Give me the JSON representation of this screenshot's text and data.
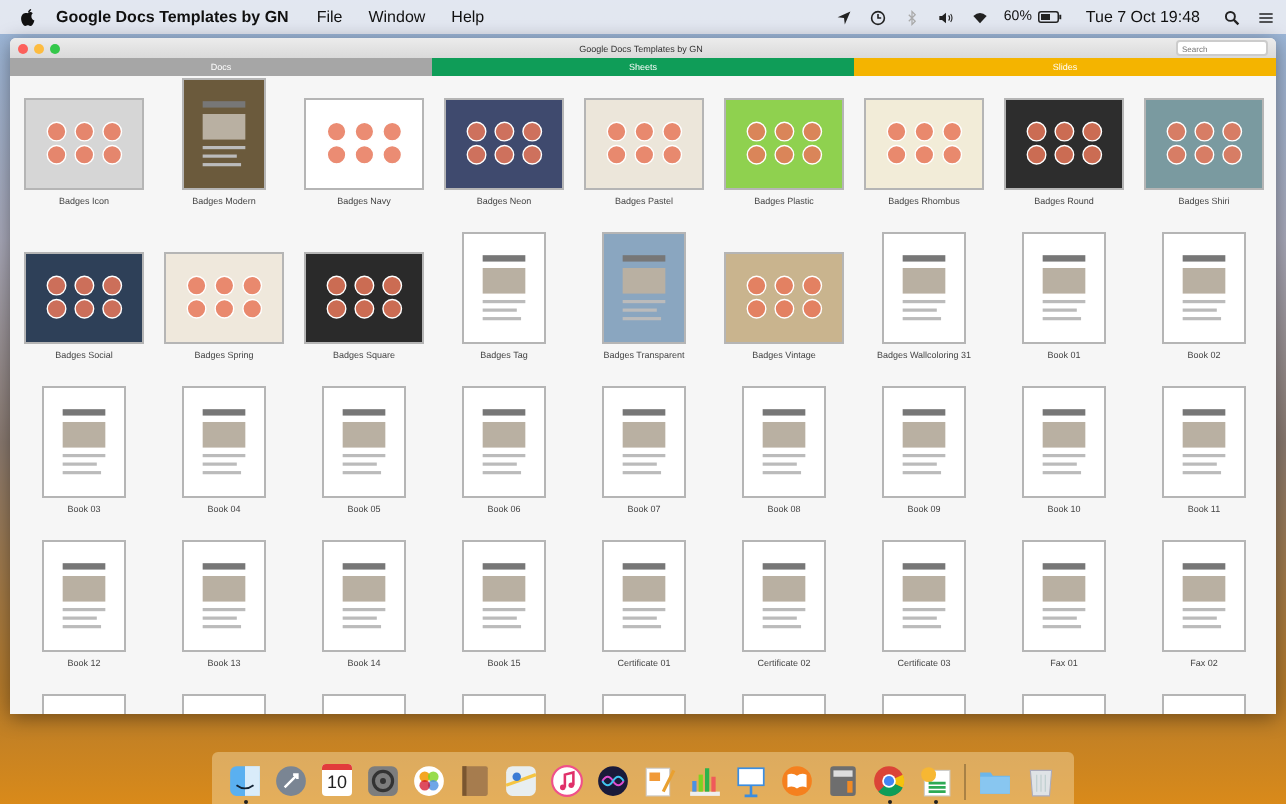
{
  "menu_bar": {
    "app_name": "Google Docs Templates by GN",
    "menus": [
      "File",
      "Window",
      "Help"
    ],
    "battery_text": "60%",
    "clock": "Tue 7 Oct  19:48"
  },
  "window": {
    "title": "Google Docs Templates by GN",
    "search": {
      "placeholder": "Search"
    }
  },
  "tabs": [
    {
      "label": "Docs",
      "color": "#a6a6a6"
    },
    {
      "label": "Sheets",
      "color": "#0f9d58"
    },
    {
      "label": "Slides",
      "color": "#f4b400"
    }
  ],
  "templates": [
    {
      "label": "Badges Icon",
      "kind": "landscape",
      "color": "#d6d6d6"
    },
    {
      "label": "Badges Modern",
      "kind": "portrait",
      "color": "#6b5a3c"
    },
    {
      "label": "Badges Navy",
      "kind": "landscape",
      "color": "#ffffff"
    },
    {
      "label": "Badges Neon",
      "kind": "landscape",
      "color": "#3f4a6e"
    },
    {
      "label": "Badges Pastel",
      "kind": "landscape",
      "color": "#ece6da"
    },
    {
      "label": "Badges Plastic",
      "kind": "landscape",
      "color": "#8fd14f"
    },
    {
      "label": "Badges Rhombus",
      "kind": "landscape",
      "color": "#f2ecd8"
    },
    {
      "label": "Badges Round",
      "kind": "landscape",
      "color": "#2d2d2d"
    },
    {
      "label": "Badges Shiri",
      "kind": "landscape",
      "color": "#7a9aa0"
    },
    {
      "label": "Badges Social",
      "kind": "landscape",
      "color": "#2e4058"
    },
    {
      "label": "Badges Spring",
      "kind": "landscape",
      "color": "#efe8dc"
    },
    {
      "label": "Badges Square",
      "kind": "landscape",
      "color": "#2a2a2a"
    },
    {
      "label": "Badges Tag",
      "kind": "portrait",
      "color": "#ffffff"
    },
    {
      "label": "Badges Transparent",
      "kind": "portrait",
      "color": "#8aa6c0"
    },
    {
      "label": "Badges Vintage",
      "kind": "landscape",
      "color": "#c9b48e"
    },
    {
      "label": "Badges Wallcoloring 31",
      "kind": "portrait",
      "color": "#ffffff"
    },
    {
      "label": "Book 01",
      "kind": "portrait",
      "color": "#ffffff"
    },
    {
      "label": "Book 02",
      "kind": "portrait",
      "color": "#ffffff"
    },
    {
      "label": "Book 03",
      "kind": "portrait",
      "color": "#ffffff"
    },
    {
      "label": "Book 04",
      "kind": "portrait",
      "color": "#ffffff"
    },
    {
      "label": "Book 05",
      "kind": "portrait",
      "color": "#ffffff"
    },
    {
      "label": "Book 06",
      "kind": "portrait",
      "color": "#ffffff"
    },
    {
      "label": "Book 07",
      "kind": "portrait",
      "color": "#ffffff"
    },
    {
      "label": "Book 08",
      "kind": "portrait",
      "color": "#ffffff"
    },
    {
      "label": "Book 09",
      "kind": "portrait",
      "color": "#ffffff"
    },
    {
      "label": "Book 10",
      "kind": "portrait",
      "color": "#ffffff"
    },
    {
      "label": "Book 11",
      "kind": "portrait",
      "color": "#ffffff"
    },
    {
      "label": "Book 12",
      "kind": "portrait",
      "color": "#ffffff"
    },
    {
      "label": "Book 13",
      "kind": "portrait",
      "color": "#ffffff"
    },
    {
      "label": "Book 14",
      "kind": "portrait",
      "color": "#ffffff"
    },
    {
      "label": "Book 15",
      "kind": "portrait",
      "color": "#ffffff"
    },
    {
      "label": "Certificate 01",
      "kind": "portrait",
      "color": "#ffffff"
    },
    {
      "label": "Certificate 02",
      "kind": "portrait",
      "color": "#ffffff"
    },
    {
      "label": "Certificate 03",
      "kind": "portrait",
      "color": "#ffffff"
    },
    {
      "label": "Fax 01",
      "kind": "portrait",
      "color": "#ffffff"
    },
    {
      "label": "Fax 02",
      "kind": "portrait",
      "color": "#ffffff"
    },
    {
      "kind": "portrait",
      "color": "#ffffff"
    },
    {
      "kind": "portrait",
      "color": "#ffffff"
    },
    {
      "kind": "portrait",
      "color": "#ffffff"
    },
    {
      "kind": "portrait",
      "color": "#ffffff"
    },
    {
      "kind": "portrait",
      "color": "#ffffff"
    },
    {
      "kind": "portrait",
      "color": "#ffffff"
    },
    {
      "kind": "portrait",
      "color": "#ffffff"
    },
    {
      "kind": "portrait",
      "color": "#ffffff"
    },
    {
      "kind": "portrait",
      "color": "#ffffff"
    }
  ],
  "dock": {
    "apps": [
      {
        "kind": "finder",
        "running": true
      },
      {
        "kind": "launchpad",
        "running": false
      },
      {
        "kind": "calendar",
        "running": false,
        "day": "10"
      },
      {
        "kind": "settings",
        "running": false
      },
      {
        "kind": "photos",
        "running": false
      },
      {
        "kind": "contacts",
        "running": false
      },
      {
        "kind": "maps",
        "running": false
      },
      {
        "kind": "music",
        "running": false
      },
      {
        "kind": "siri",
        "running": false
      },
      {
        "kind": "pages",
        "running": false
      },
      {
        "kind": "numbers",
        "running": false
      },
      {
        "kind": "keynote",
        "running": false
      },
      {
        "kind": "books",
        "running": false
      },
      {
        "kind": "calculator",
        "running": false
      },
      {
        "kind": "browser",
        "running": true
      },
      {
        "kind": "spreadsheet",
        "running": true
      },
      {
        "kind": "folder",
        "running": false
      },
      {
        "kind": "trash",
        "running": false
      }
    ]
  }
}
